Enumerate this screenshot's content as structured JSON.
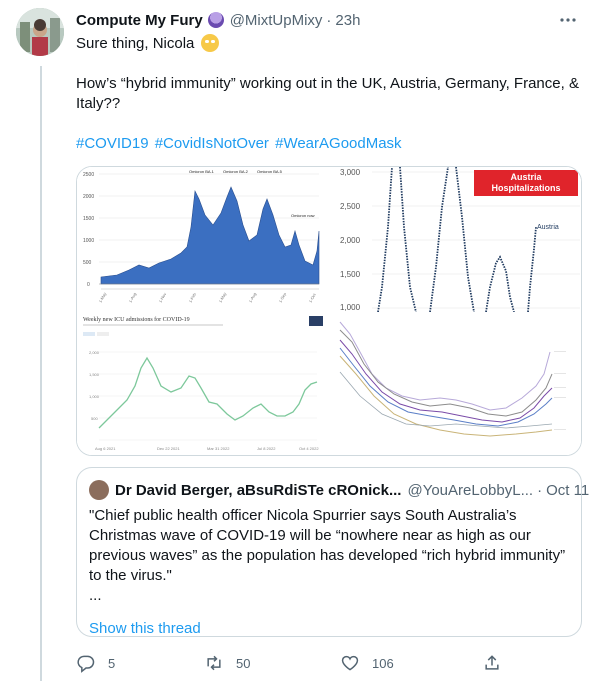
{
  "tweet": {
    "author_name": "Compute My Fury",
    "handle": "@MixtUpMixy",
    "separator": "·",
    "time": "23h",
    "line1": "Sure thing, Nicola",
    "line2": "How’s “hybrid immunity” working out in the UK, Austria, Germany, France, & Italy??",
    "hashtags": [
      "#COVID19",
      "#CovidIsNotOver",
      "#WearAGoodMask"
    ]
  },
  "media": {
    "panel1": {
      "y_ticks": [
        "2500",
        "2000",
        "1500",
        "1000",
        "500",
        "0"
      ],
      "peak_labels": [
        "Omicron BA.1",
        "Omicron BA.2",
        "Omicron BA.5",
        "Omicron now"
      ]
    },
    "panel2": {
      "badge_line1": "Austria",
      "badge_line2": "Hospitalizations",
      "series_label": "Austria",
      "y_ticks": [
        "3,000",
        "2,500",
        "2,000",
        "1,500",
        "1,000"
      ]
    },
    "panel3": {
      "title": "Weekly new ICU admissions for COVID-19"
    }
  },
  "quote": {
    "author_name": "Dr David Berger, aBsuRdiSTe cROnick...",
    "handle": "@YouAreLobbyL...",
    "separator": "·",
    "date": "Oct 11",
    "text": "\"Chief public health officer Nicola Spurrier says South Australia’s Christmas wave of COVID-19 will be “nowhere near as high as our previous waves” as the population has developed “rich hybrid immunity” to the virus.\"",
    "ellipsis": "...",
    "show_thread": "Show this thread"
  },
  "actions": {
    "replies": "5",
    "retweets": "50",
    "likes": "106"
  },
  "colors": {
    "link": "#1d9bf0",
    "muted": "#536471",
    "badge": "#e0242b",
    "bars": "#3b6fc1"
  },
  "icons": [
    "more-icon",
    "reply-icon",
    "retweet-icon",
    "like-icon",
    "share-icon"
  ]
}
